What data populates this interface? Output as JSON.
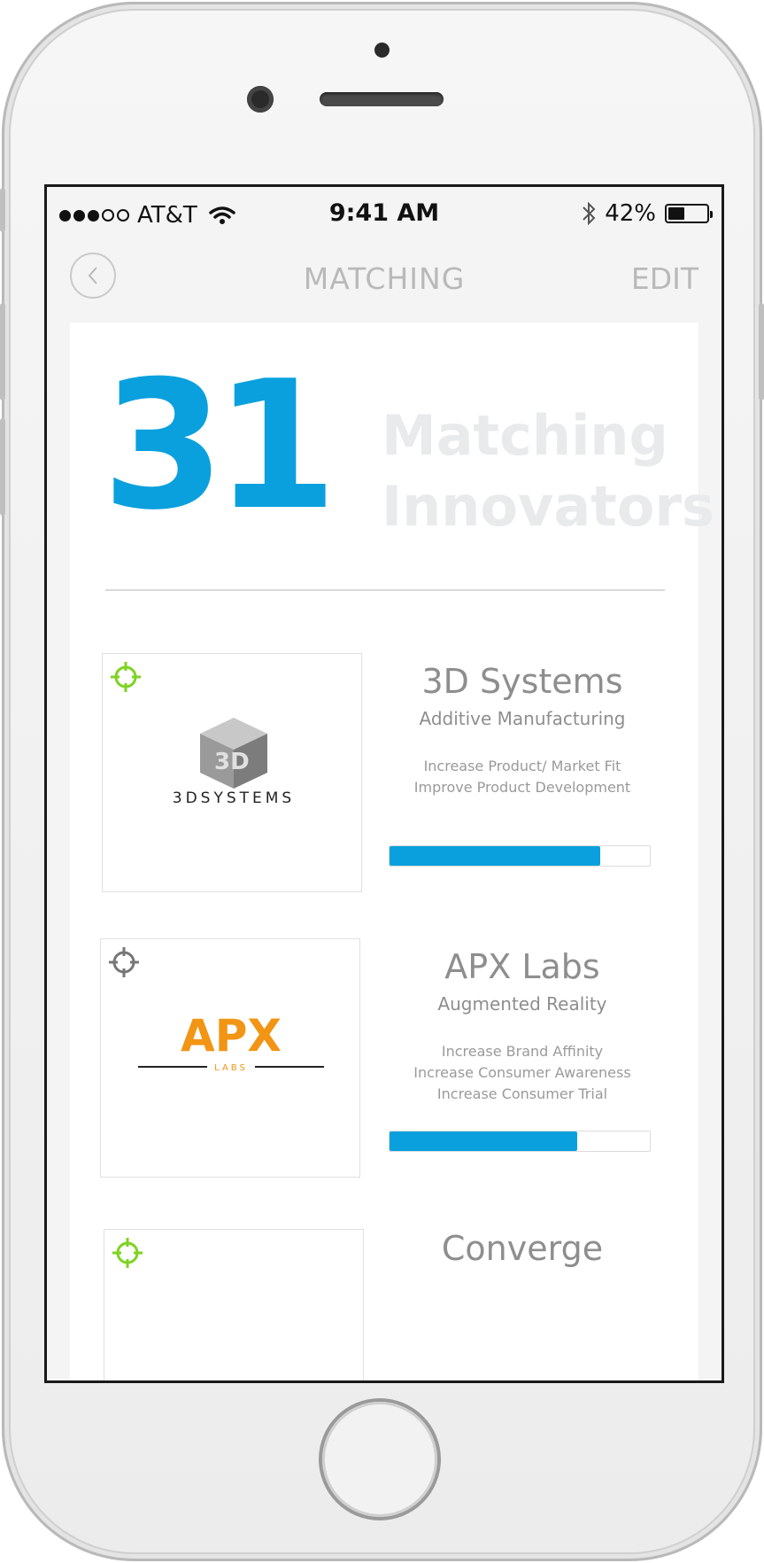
{
  "status_bar": {
    "carrier": "AT&T",
    "time": "9:41 AM",
    "battery_percent": "42%",
    "battery_level": 0.42,
    "signal_dots": [
      true,
      true,
      true,
      false,
      false
    ]
  },
  "nav": {
    "back_icon": "chevron-left-icon",
    "title": "MATCHING",
    "edit_label": "EDIT"
  },
  "summary": {
    "count": "31",
    "label_line1": "Matching",
    "label_line2": "Innovators"
  },
  "innovators": [
    {
      "name": "3D Systems",
      "category": "Additive Manufacturing",
      "goals": [
        "Increase Product/ Market Fit",
        "Improve Product Development"
      ],
      "score": 81,
      "score_label": "81",
      "logo_text": "3DSYSTEMS",
      "target_color": "#7ed321"
    },
    {
      "name": "APX Labs",
      "category": "Augmented Reality",
      "goals": [
        "Increase Brand Affinity",
        "Increase Consumer Awareness",
        "Increase Consumer Trial"
      ],
      "score": 72,
      "score_label": "72",
      "logo_text": "APX",
      "logo_subtext": "LABS",
      "target_color": "#777777"
    },
    {
      "name": "Converge",
      "target_color": "#7ed321"
    }
  ],
  "colors": {
    "accent": "#0aa0dd",
    "muted_text": "#8e8e8e",
    "apx_orange": "#f29414"
  }
}
